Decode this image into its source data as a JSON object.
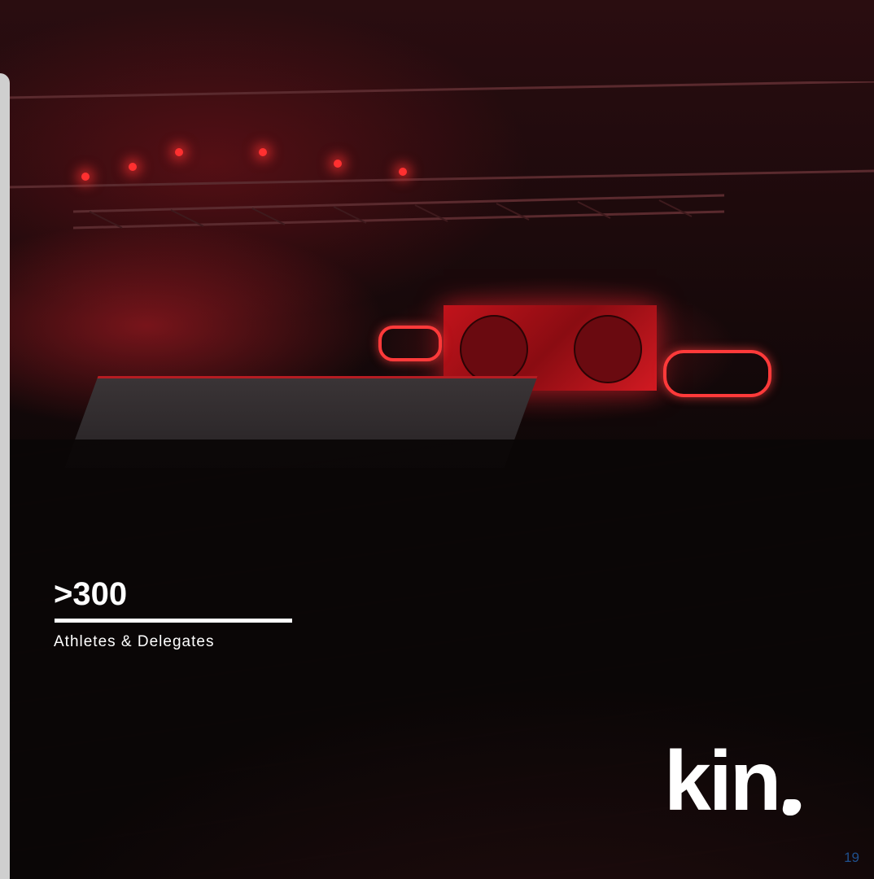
{
  "stat": {
    "value": ">300",
    "label": "Athletes & Delegates"
  },
  "logo": {
    "text": "kin"
  },
  "page_number": "19",
  "colors": {
    "stat_text": "#ffffff",
    "page_number": "#1f4f8c",
    "accent_red": "#d21a22",
    "left_bar": "#cfcfcf"
  }
}
